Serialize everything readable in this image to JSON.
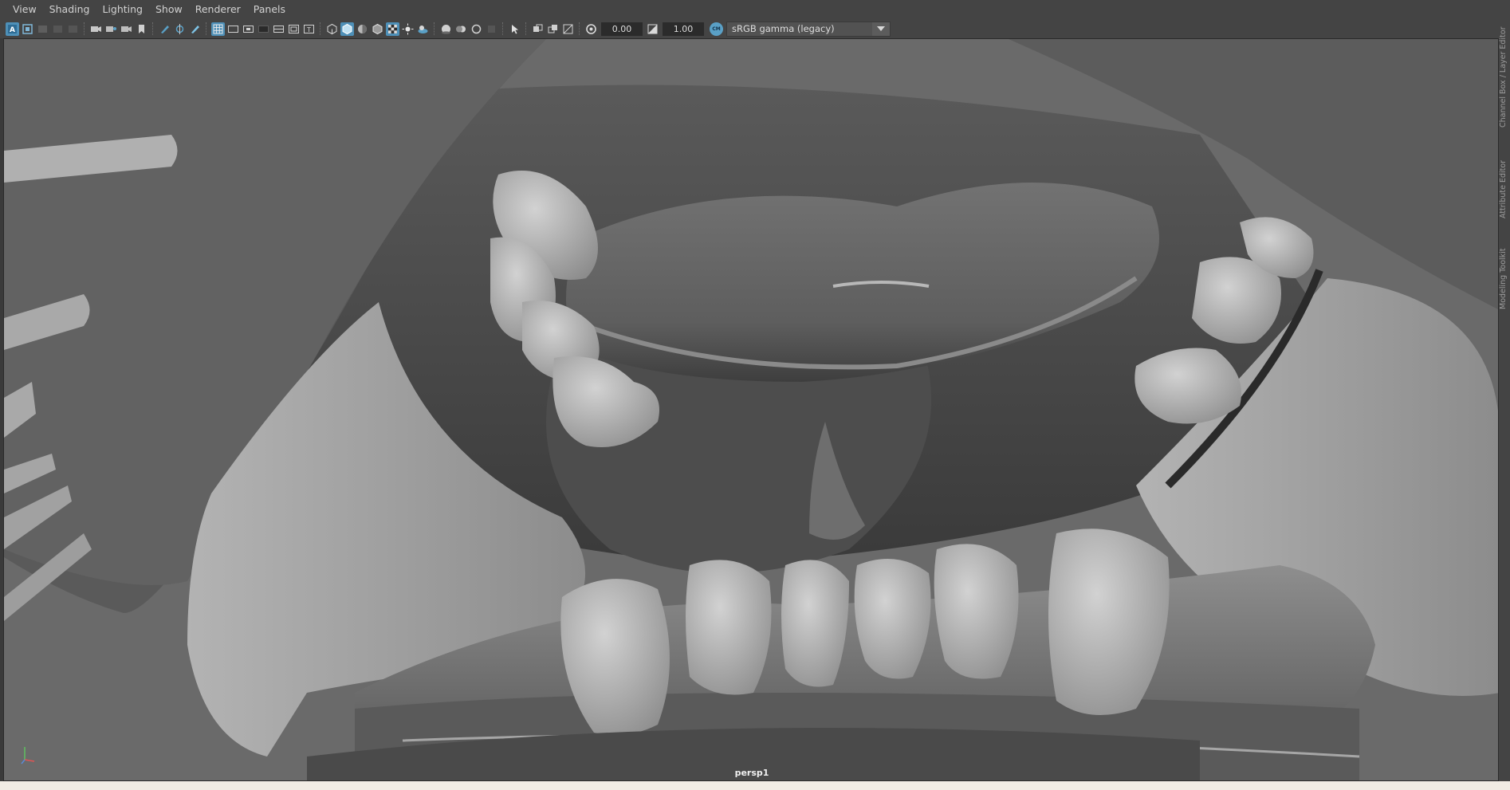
{
  "menubar": {
    "items": [
      "View",
      "Shading",
      "Lighting",
      "Show",
      "Renderer",
      "Panels"
    ]
  },
  "toolbar": {
    "exposure_value": "0.00",
    "gamma_value": "1.00",
    "color_space": "sRGB gamma (legacy)",
    "icons": [
      "select-camera-icon",
      "camera-attributes-icon",
      "bookmark-icon",
      "grid-icon",
      "film-gate-icon",
      "resolution-gate-icon",
      "wireframe-icon",
      "smooth-shade-icon",
      "textured-icon",
      "lights-icon",
      "shadows-icon",
      "ambient-occlusion-icon",
      "isolate-select-icon",
      "xray-icon",
      "exposure-icon",
      "gamma-icon"
    ]
  },
  "viewport": {
    "camera_label": "persp1",
    "background_color": "#6a6a6a",
    "model_color": "#9a9a9a"
  },
  "side_panel": {
    "tabs": [
      "Channel Box / Layer Editor",
      "Attribute Editor",
      "Modeling Toolkit"
    ]
  },
  "colors": {
    "accent": "#4e90b8",
    "toolbar_bg": "#444444"
  }
}
